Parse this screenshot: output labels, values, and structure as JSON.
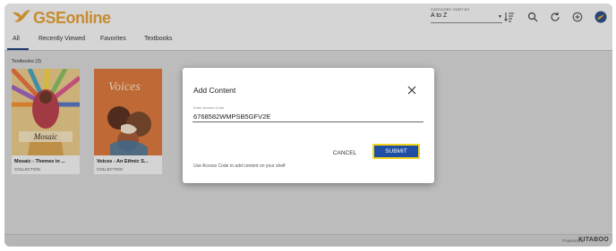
{
  "app": {
    "name": "GSEonline"
  },
  "header": {
    "sort_label": "CATEGORY SORT BY",
    "sort_value": "A to Z",
    "icons": [
      "sort-icon",
      "search-icon",
      "refresh-icon",
      "add-icon",
      "avatar"
    ]
  },
  "tabs": [
    {
      "label": "All",
      "active": true
    },
    {
      "label": "Recently Viewed",
      "active": false
    },
    {
      "label": "Favorites",
      "active": false
    },
    {
      "label": "Textbooks",
      "active": false
    }
  ],
  "section": {
    "title": "Textbooks (3)"
  },
  "books": [
    {
      "title": "Mosaic - Themes in ...",
      "type": "COLLECTION",
      "cover_text": "Mosaic"
    },
    {
      "title": "Voices - An Ethnic S...",
      "type": "COLLECTION",
      "cover_text": "Voices"
    }
  ],
  "footer": {
    "powered_by": "Powered by",
    "brand": "KITABOO"
  },
  "modal": {
    "title": "Add Content",
    "field_label": "Enter Access Code",
    "field_value": "6768582WMPSB5GFV2E",
    "cancel_label": "CANCEL",
    "submit_label": "SUBMIT",
    "hint": "Use Access Code to add content on your shelf"
  },
  "colors": {
    "brand": "#e2a037",
    "primary": "#1f4ea3",
    "focus": "#f2d21b",
    "tab_active": "#1f3f7a"
  }
}
